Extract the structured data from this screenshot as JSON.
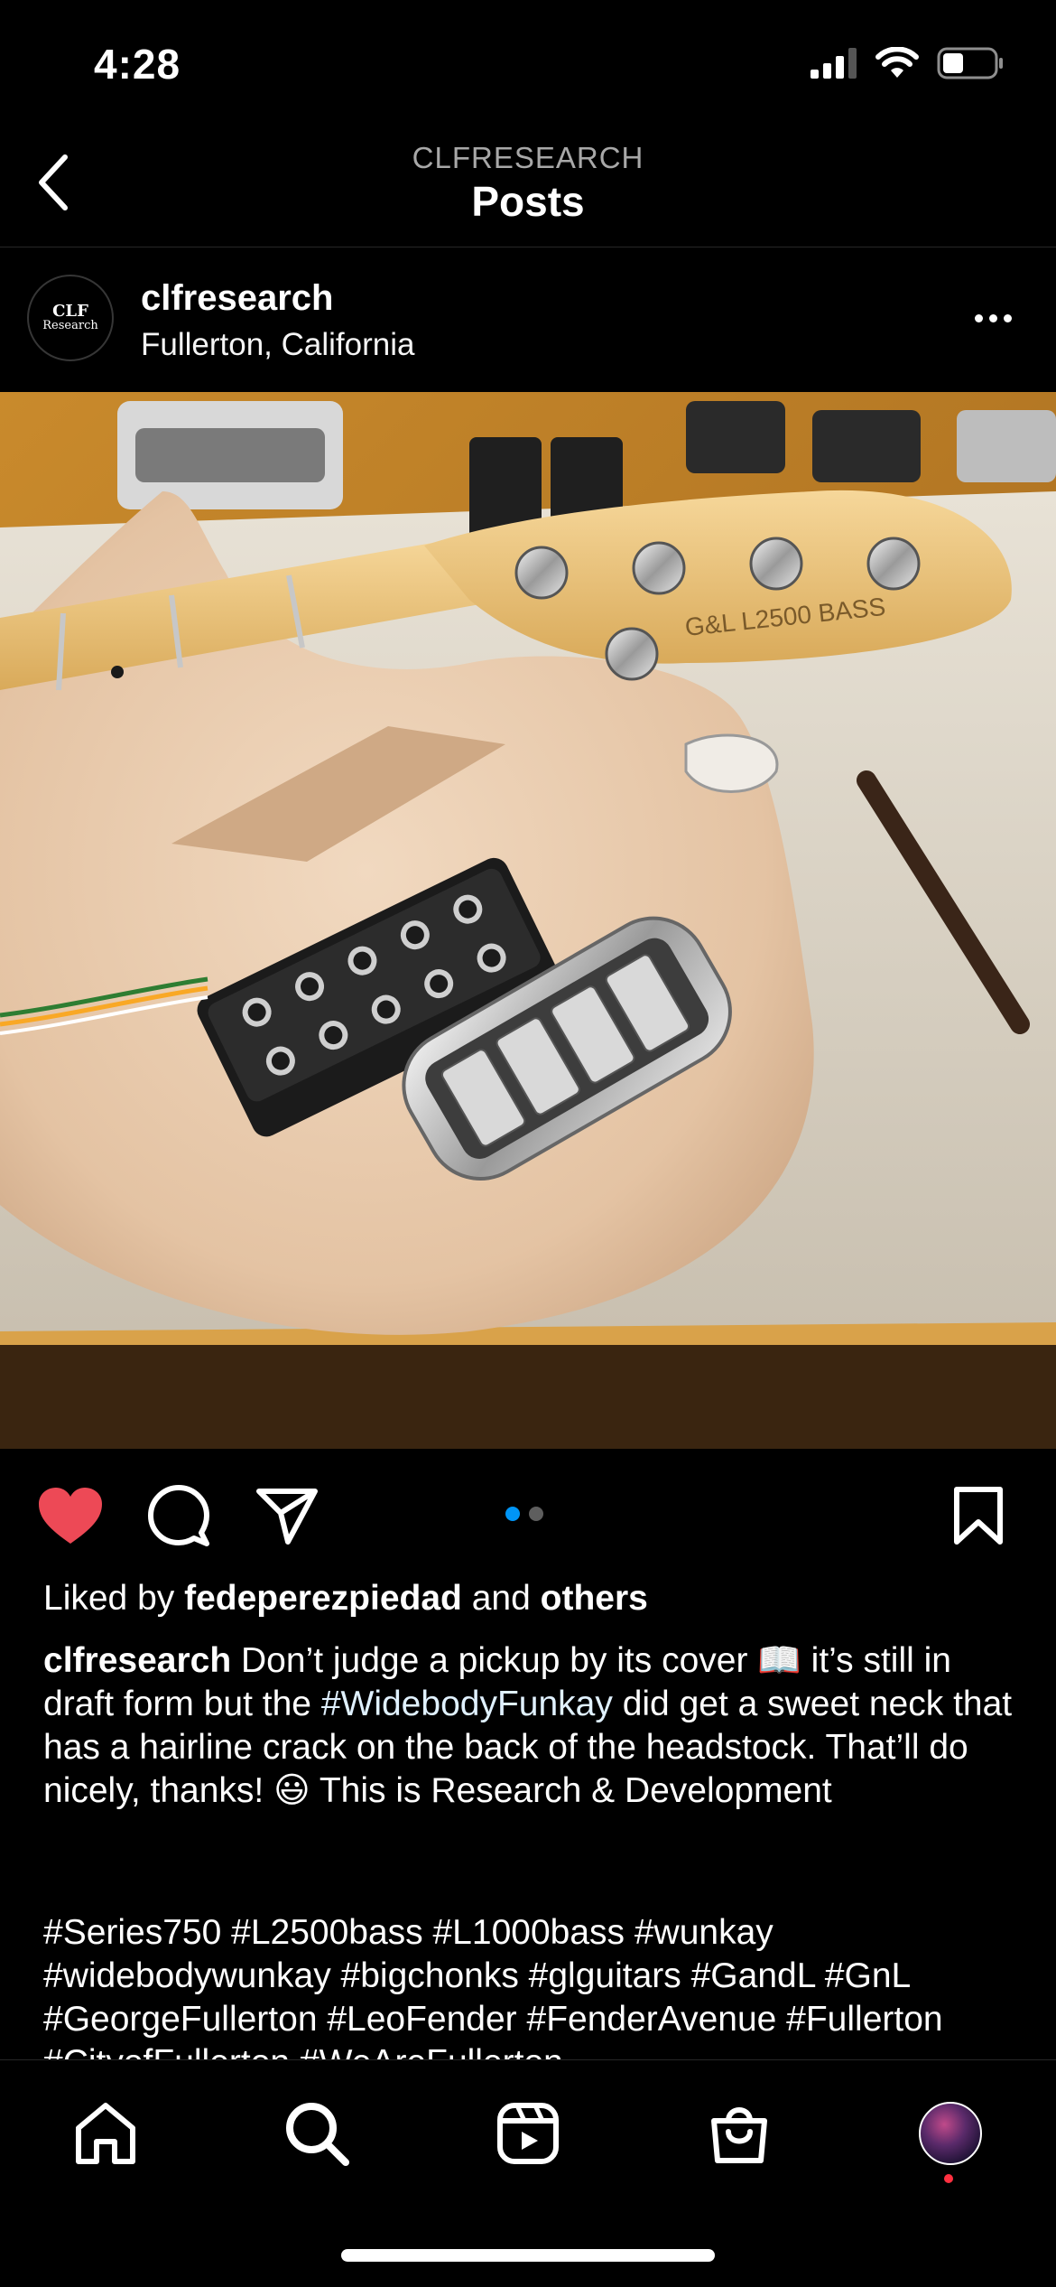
{
  "status": {
    "time": "4:28"
  },
  "header": {
    "subtitle": "CLFRESEARCH",
    "title": "Posts"
  },
  "post": {
    "avatar_text_top": "CLF",
    "avatar_text_bottom": "Research",
    "username": "clfresearch",
    "location": "Fullerton, California",
    "carousel": {
      "count": 2,
      "active_index": 0
    },
    "liked": true,
    "likes": {
      "prefix": "Liked by",
      "user": "fedeperezpiedad",
      "and": "and",
      "others": "others"
    },
    "caption": {
      "username": "clfresearch",
      "part1": "Don’t judge a pickup by its cover 📖  it’s still in draft form but the",
      "hashtag": "#WidebodyFunkay",
      "part2": "did get a sweet neck that has a hairline crack on the back of the headstock.  That’ll do nicely, thanks! 😃 This is Research & Development"
    },
    "hashtags": "#Series750 #L2500bass #L1000bass #wunkay #widebodywunkay #bigchonks #glguitars #GandL #GnL #GeorgeFullerton #LeoFender #FenderAvenue #Fullerton #CityofFullerton #WeAreFullerton"
  },
  "icons": {
    "back": "chevron-left-icon",
    "more": "more-horizontal-icon",
    "like": "heart-icon",
    "comment": "comment-icon",
    "share": "paper-plane-icon",
    "save": "bookmark-icon",
    "home": "home-icon",
    "search": "search-icon",
    "reels": "reels-icon",
    "shop": "shopping-bag-icon",
    "profile": "profile-avatar"
  },
  "colors": {
    "background": "#000000",
    "like_red": "#ed4956",
    "carousel_active": "#0095f6",
    "carousel_inactive": "#5e5e5e",
    "notification_dot": "#ff3040"
  }
}
